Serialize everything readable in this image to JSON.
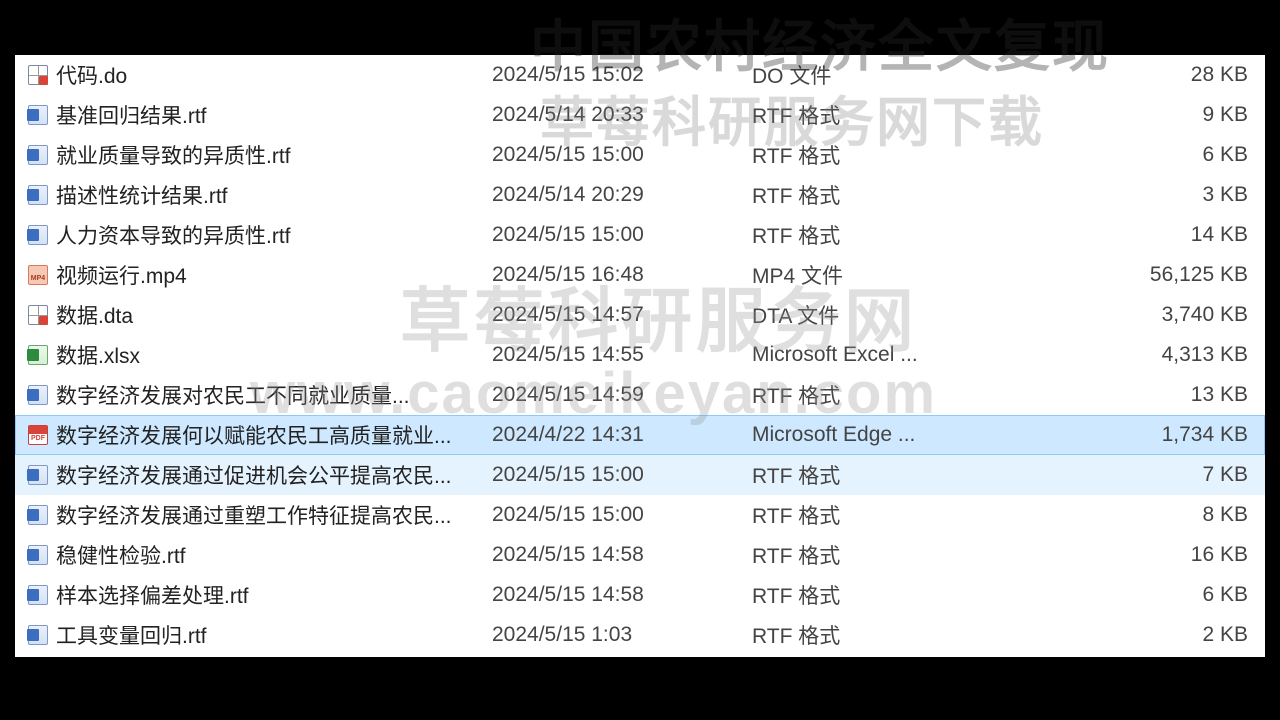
{
  "watermarks": {
    "line1": "中国农村经济全文复现",
    "line2": "草莓科研服务网下载",
    "line3": "草莓科研服务网",
    "line4": "www.caomeikeyan.com"
  },
  "files": [
    {
      "icon": "grid",
      "name": "代码.do",
      "date": "2024/5/15 15:02",
      "type": "DO 文件",
      "size": "28 KB",
      "state": ""
    },
    {
      "icon": "word",
      "name": "基准回归结果.rtf",
      "date": "2024/5/14 20:33",
      "type": "RTF 格式",
      "size": "9 KB",
      "state": ""
    },
    {
      "icon": "word",
      "name": "就业质量导致的异质性.rtf",
      "date": "2024/5/15 15:00",
      "type": "RTF 格式",
      "size": "6 KB",
      "state": ""
    },
    {
      "icon": "word",
      "name": "描述性统计结果.rtf",
      "date": "2024/5/14 20:29",
      "type": "RTF 格式",
      "size": "3 KB",
      "state": ""
    },
    {
      "icon": "word",
      "name": "人力资本导致的异质性.rtf",
      "date": "2024/5/15 15:00",
      "type": "RTF 格式",
      "size": "14 KB",
      "state": ""
    },
    {
      "icon": "mp4",
      "name": "视频运行.mp4",
      "date": "2024/5/15 16:48",
      "type": "MP4 文件",
      "size": "56,125 KB",
      "state": ""
    },
    {
      "icon": "grid",
      "name": "数据.dta",
      "date": "2024/5/15 14:57",
      "type": "DTA 文件",
      "size": "3,740 KB",
      "state": ""
    },
    {
      "icon": "xls",
      "name": "数据.xlsx",
      "date": "2024/5/15 14:55",
      "type": "Microsoft Excel ...",
      "size": "4,313 KB",
      "state": ""
    },
    {
      "icon": "word",
      "name": "数字经济发展对农民工不同就业质量...",
      "date": "2024/5/15 14:59",
      "type": "RTF 格式",
      "size": "13 KB",
      "state": ""
    },
    {
      "icon": "pdf",
      "name": "数字经济发展何以赋能农民工高质量就业...",
      "date": "2024/4/22 14:31",
      "type": "Microsoft Edge ...",
      "size": "1,734 KB",
      "state": "selected"
    },
    {
      "icon": "word",
      "name": "数字经济发展通过促进机会公平提高农民...",
      "date": "2024/5/15 15:00",
      "type": "RTF 格式",
      "size": "7 KB",
      "state": "hover"
    },
    {
      "icon": "word",
      "name": "数字经济发展通过重塑工作特征提高农民...",
      "date": "2024/5/15 15:00",
      "type": "RTF 格式",
      "size": "8 KB",
      "state": ""
    },
    {
      "icon": "word",
      "name": "稳健性检验.rtf",
      "date": "2024/5/15 14:58",
      "type": "RTF 格式",
      "size": "16 KB",
      "state": ""
    },
    {
      "icon": "word",
      "name": "样本选择偏差处理.rtf",
      "date": "2024/5/15 14:58",
      "type": "RTF 格式",
      "size": "6 KB",
      "state": ""
    },
    {
      "icon": "word",
      "name": "工具变量回归.rtf",
      "date": "2024/5/15 1:03",
      "type": "RTF 格式",
      "size": "2 KB",
      "state": ""
    }
  ]
}
